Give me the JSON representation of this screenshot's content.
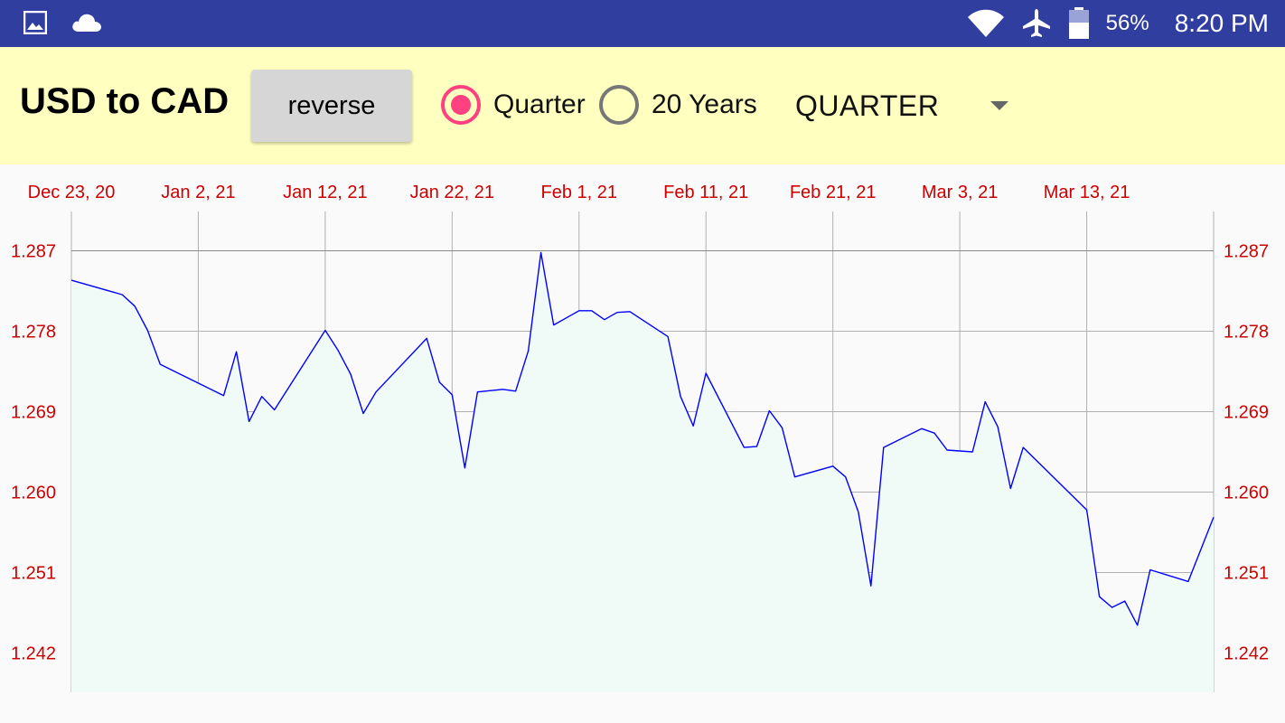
{
  "status_bar": {
    "left_icons": [
      "image-icon",
      "cloud-icon"
    ],
    "battery": "56%",
    "time": "8:20 PM"
  },
  "toolbar": {
    "title": "USD to CAD",
    "reverse_label": "reverse",
    "radio_quarter": "Quarter",
    "radio_years": "20 Years",
    "selected_radio": "Quarter",
    "period_select": "QUARTER"
  },
  "colors": {
    "status_bar": "#303f9f",
    "toolbar_bg": "#ffffbf",
    "accent": "#ff4081",
    "line": "#0000ff",
    "fill": "#f0fbf8",
    "tick_text": "#cc0000"
  },
  "chart_data": {
    "type": "area",
    "title": "",
    "xlabel": "",
    "ylabel": "",
    "x_tick_labels": [
      "Dec 23, 20",
      "Jan 2, 21",
      "Jan 12, 21",
      "Jan 22, 21",
      "Feb 1, 21",
      "Feb 11, 21",
      "Feb 21, 21",
      "Mar 3, 21",
      "Mar 13, 21"
    ],
    "y_tick_labels": [
      "1.287",
      "1.278",
      "1.269",
      "1.260",
      "1.251",
      "1.242"
    ],
    "y_ticks": [
      1.287,
      1.278,
      1.269,
      1.26,
      1.251,
      1.242
    ],
    "ylim": [
      1.2376,
      1.2914
    ],
    "xlim": [
      "2020-12-23",
      "2021-03-23"
    ],
    "grid": true,
    "series": [
      {
        "x": [
          "2020-12-23",
          "2020-12-27",
          "2020-12-28",
          "2020-12-29",
          "2020-12-30",
          "2021-01-04",
          "2021-01-05",
          "2021-01-06",
          "2021-01-07",
          "2021-01-08",
          "2021-01-12",
          "2021-01-13",
          "2021-01-14",
          "2021-01-15",
          "2021-01-16",
          "2021-01-20",
          "2021-01-21",
          "2021-01-22",
          "2021-01-23",
          "2021-01-24",
          "2021-01-26",
          "2021-01-27",
          "2021-01-28",
          "2021-01-29",
          "2021-01-30",
          "2021-02-01",
          "2021-02-02",
          "2021-02-03",
          "2021-02-04",
          "2021-02-05",
          "2021-02-08",
          "2021-02-09",
          "2021-02-10",
          "2021-02-11",
          "2021-02-14",
          "2021-02-15",
          "2021-02-16",
          "2021-02-17",
          "2021-02-18",
          "2021-02-21",
          "2021-02-22",
          "2021-02-23",
          "2021-02-24",
          "2021-02-25",
          "2021-02-28",
          "2021-03-01",
          "2021-03-02",
          "2021-03-04",
          "2021-03-05",
          "2021-03-06",
          "2021-03-07",
          "2021-03-08",
          "2021-03-13",
          "2021-03-14",
          "2021-03-15",
          "2021-03-16",
          "2021-03-17",
          "2021-03-18",
          "2021-03-21",
          "2021-03-23"
        ],
        "values": [
          1.2837,
          1.2821,
          1.2808,
          1.2781,
          1.2743,
          1.2708,
          1.2757,
          1.2679,
          1.2707,
          1.2692,
          1.2781,
          1.2759,
          1.2732,
          1.2688,
          1.2712,
          1.2772,
          1.2723,
          1.2709,
          1.2627,
          1.2712,
          1.2715,
          1.2713,
          1.2758,
          1.2868,
          1.2787,
          1.2803,
          1.2803,
          1.2793,
          1.2801,
          1.2802,
          1.2774,
          1.2707,
          1.2674,
          1.2733,
          1.265,
          1.2651,
          1.2691,
          1.2672,
          1.2617,
          1.2629,
          1.2617,
          1.2578,
          1.2495,
          1.265,
          1.2671,
          1.2666,
          1.2647,
          1.2645,
          1.2701,
          1.2673,
          1.2604,
          1.265,
          1.258,
          1.2483,
          1.2471,
          1.2478,
          1.2451,
          1.2513,
          1.25,
          1.2572
        ]
      }
    ]
  }
}
